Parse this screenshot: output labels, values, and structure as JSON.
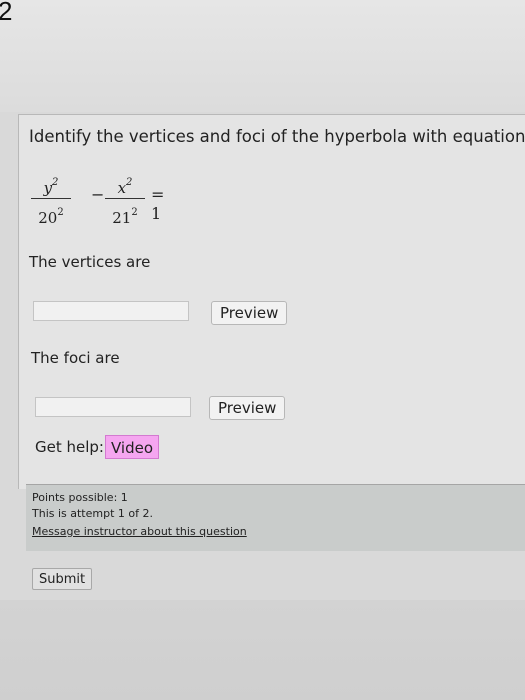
{
  "question_number": "2",
  "prompt": "Identify the vertices and foci of the hyperbola with equation",
  "equation": {
    "term1_num_base": "y",
    "term1_num_exp": "2",
    "term1_den_base": "20",
    "term1_den_exp": "2",
    "operator": "−",
    "term2_num_base": "x",
    "term2_num_exp": "2",
    "term2_den_base": "21",
    "term2_den_exp": "2",
    "equals": "= 1"
  },
  "vertices": {
    "label": "The vertices are",
    "value": "",
    "preview_label": "Preview"
  },
  "foci": {
    "label": "The foci are",
    "value": "",
    "preview_label": "Preview"
  },
  "help": {
    "label": "Get help:",
    "video_label": "Video"
  },
  "info": {
    "points": "Points possible: 1",
    "attempt": "This is attempt 1 of 2.",
    "message_link": "Message instructor about this question"
  },
  "submit_label": "Submit"
}
